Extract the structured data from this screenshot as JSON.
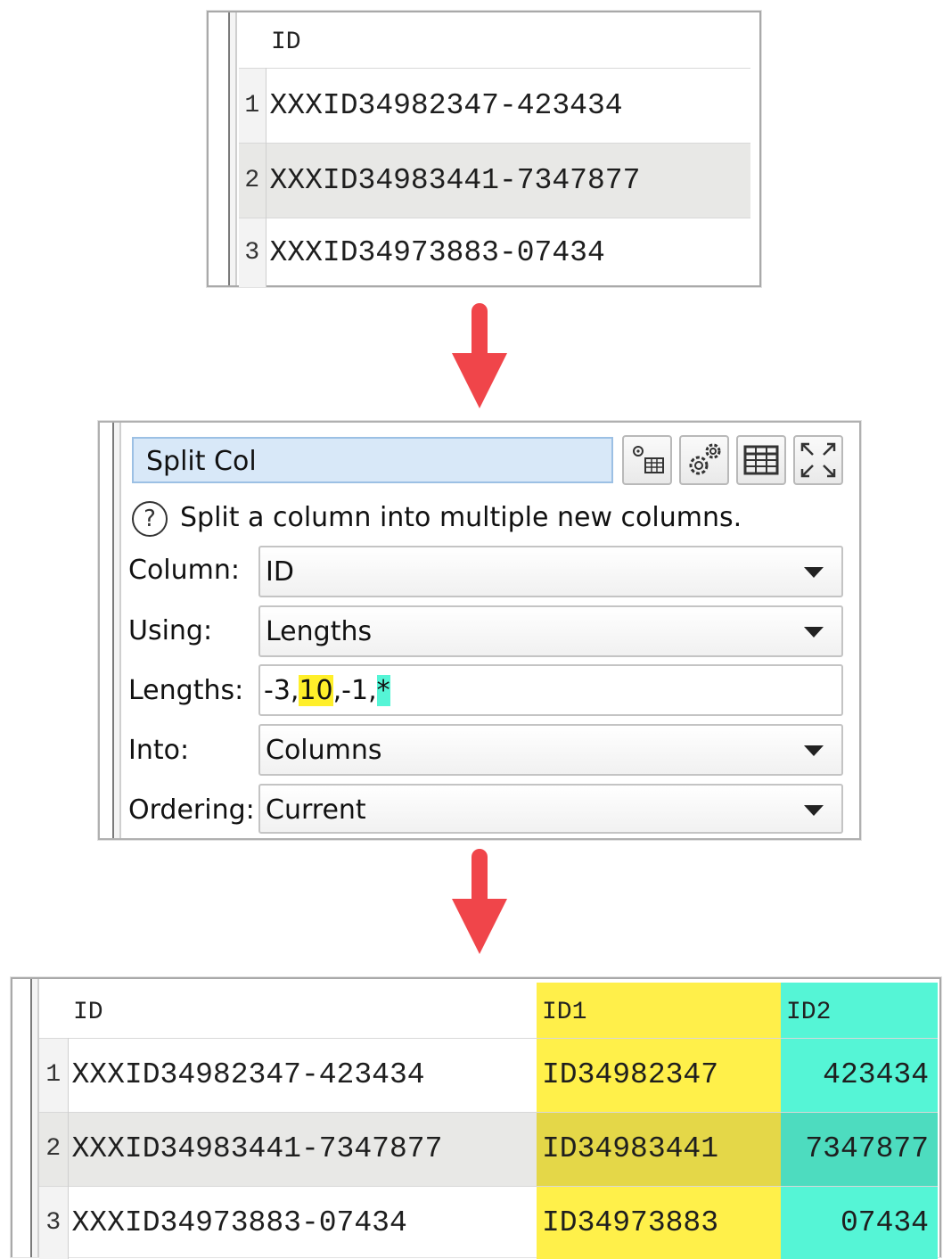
{
  "top_table": {
    "header": "ID",
    "rows": [
      {
        "num": "1",
        "id": "XXXID34982347-423434"
      },
      {
        "num": "2",
        "id": "XXXID34983441-7347877"
      },
      {
        "num": "3",
        "id": "XXXID34973883-07434"
      }
    ]
  },
  "dialog": {
    "title": "Split Col",
    "description": "Split a column into multiple new columns.",
    "help_symbol": "?",
    "toolbar_icons": [
      "table-settings-icon",
      "gears-icon",
      "table-icon",
      "expand-icon"
    ],
    "fields": {
      "column_label": "Column:",
      "column_value": "ID",
      "using_label": "Using:",
      "using_value": "Lengths",
      "lengths_label": "Lengths:",
      "lengths_parts": [
        "-3,",
        "10",
        ",-1,",
        "*"
      ],
      "into_label": "Into:",
      "into_value": "Columns",
      "ordering_label": "Ordering:",
      "ordering_value": "Current"
    }
  },
  "bottom_table": {
    "headers": [
      "ID",
      "ID1",
      "ID2"
    ],
    "rows": [
      {
        "num": "1",
        "id": "XXXID34982347-423434",
        "id1": "ID34982347",
        "id2": "423434"
      },
      {
        "num": "2",
        "id": "XXXID34983441-7347877",
        "id1": "ID34983441",
        "id2": "7347877"
      },
      {
        "num": "3",
        "id": "XXXID34973883-07434",
        "id1": "ID34973883",
        "id2": "07434"
      }
    ]
  },
  "colors": {
    "arrow": "#f0454a",
    "highlight_yellow": "#ffef2a",
    "highlight_cyan": "#55f5d6"
  }
}
